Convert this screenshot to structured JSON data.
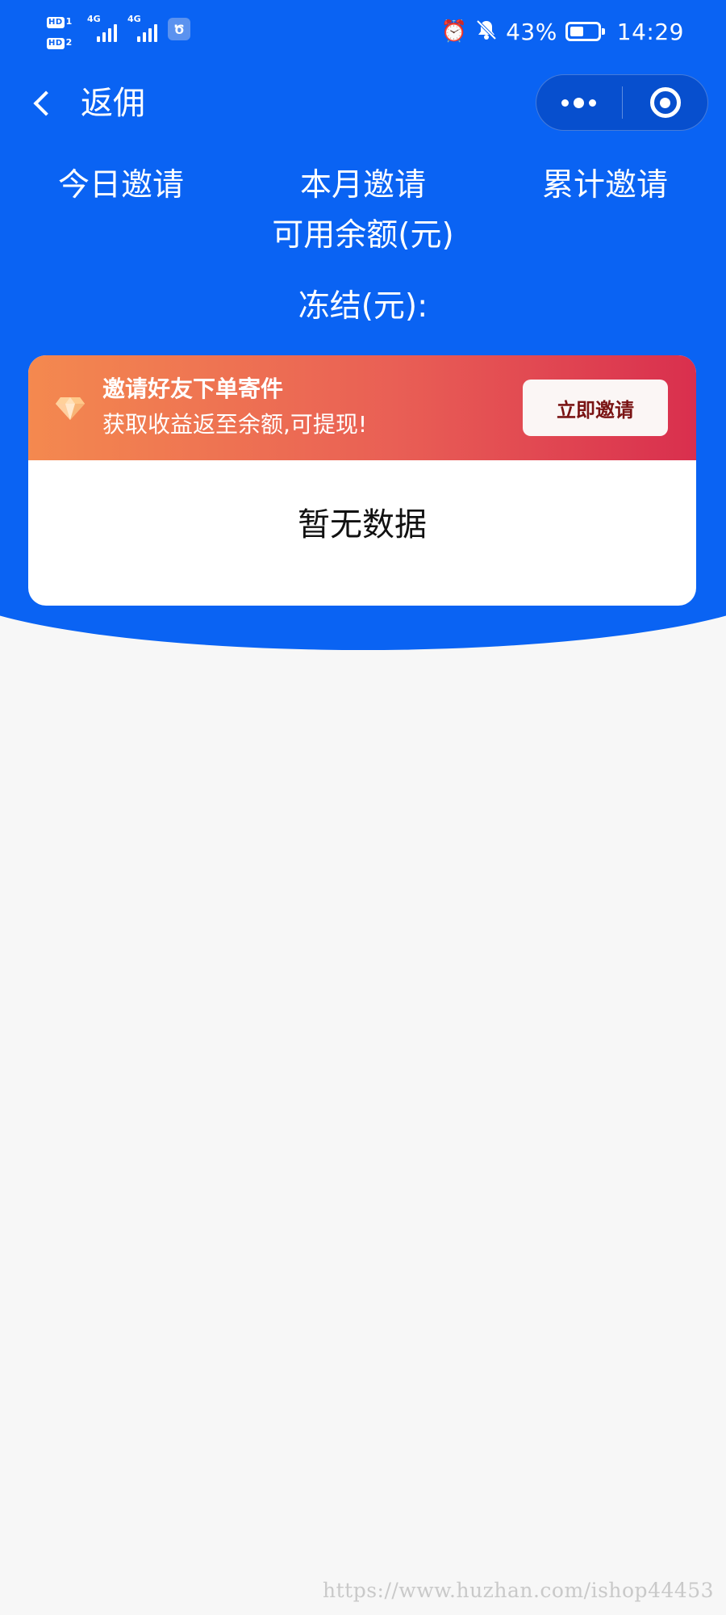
{
  "status_bar": {
    "sim1_tag": "HD",
    "sim1_num": "1",
    "sim2_tag": "HD",
    "sim2_num": "2",
    "network1": "4G",
    "network2": "4G",
    "app_icon_char": "Ծ",
    "battery_percent": "43%",
    "battery_level": 0.43,
    "time": "14:29",
    "icons": [
      "alarm-icon",
      "mute-bell-icon",
      "battery-icon"
    ]
  },
  "nav": {
    "title": "返佣",
    "back_icon": "chevron-left-icon",
    "more_icon": "more-dots-icon",
    "close_icon": "target-close-icon"
  },
  "stats": {
    "today_label": "今日邀请",
    "month_label": "本月邀请",
    "total_label": "累计邀请",
    "balance_label": "可用余额(元)",
    "frozen_label": "冻结(元):"
  },
  "invite_card": {
    "title": "邀请好友下单寄件",
    "subtitle": "获取收益返至余额,可提现!",
    "button_label": "立即邀请",
    "gem_icon": "diamond-icon",
    "gradient_start": "#f4894f",
    "gradient_end": "#d92f4e",
    "empty_text": "暂无数据"
  },
  "theme": {
    "primary_blue": "#0a63f3",
    "page_bg": "#f7f7f7"
  },
  "watermark": {
    "text": "https://www.huzhan.com/ishop44453"
  }
}
